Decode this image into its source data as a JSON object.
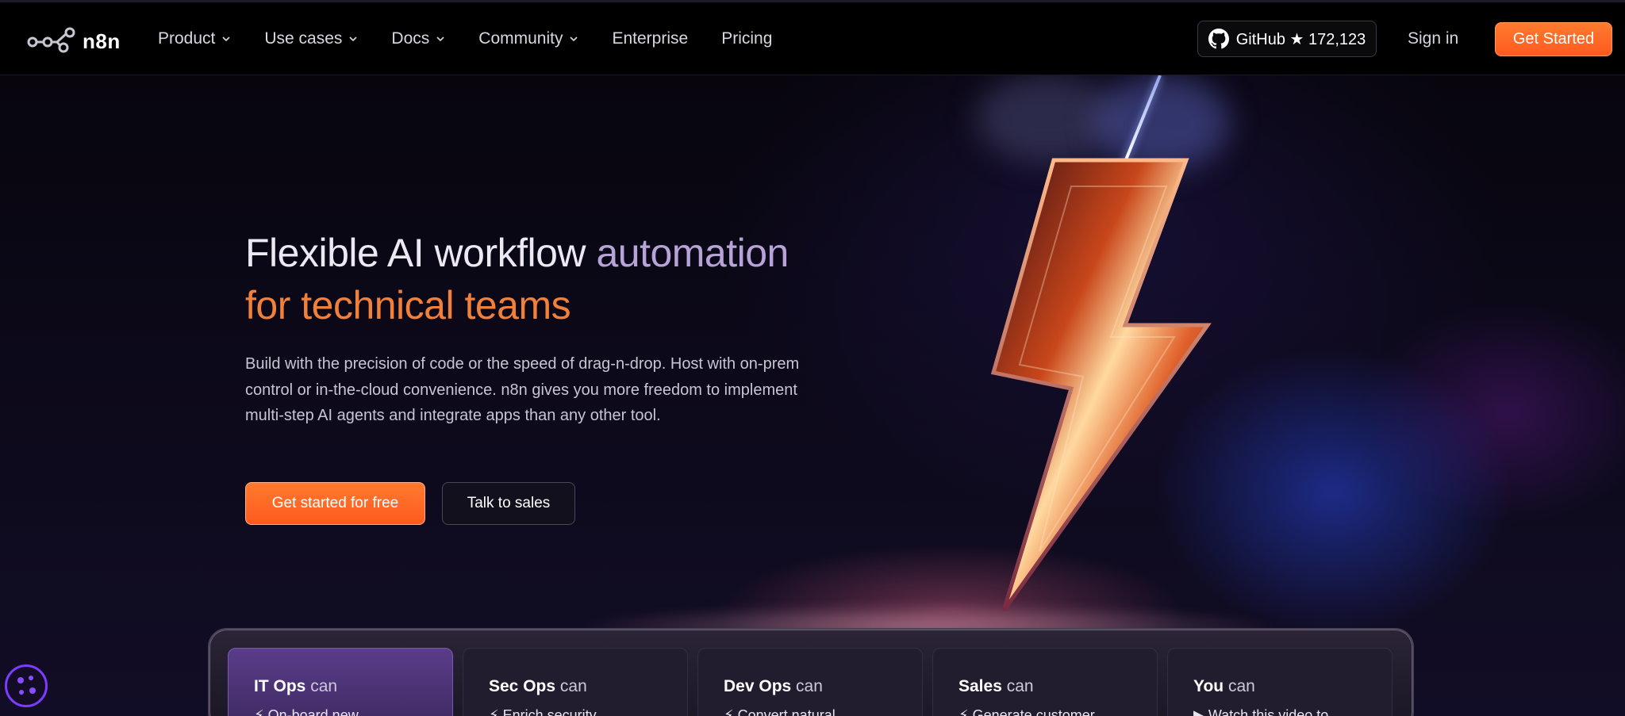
{
  "nav": {
    "logo_text": "n8n",
    "items": [
      {
        "label": "Product",
        "has_dropdown": true
      },
      {
        "label": "Use cases",
        "has_dropdown": true
      },
      {
        "label": "Docs",
        "has_dropdown": true
      },
      {
        "label": "Community",
        "has_dropdown": true
      },
      {
        "label": "Enterprise",
        "has_dropdown": false
      },
      {
        "label": "Pricing",
        "has_dropdown": false
      }
    ],
    "github_label": "GitHub ★ 172,123",
    "signin_label": "Sign in",
    "get_started_label": "Get Started"
  },
  "hero": {
    "title_line1_a": "Flexible AI workflow",
    "title_line1_b": "automation",
    "title_line2": "for technical teams",
    "description": "Build with the precision of code or the speed of drag-n-drop. Host with on-prem control or in-the-cloud convenience. n8n gives you more freedom to implement multi-step AI agents and integrate apps than any other tool.",
    "primary_cta": "Get started for free",
    "secondary_cta": "Talk to sales"
  },
  "cards": [
    {
      "team": "IT Ops",
      "suffix": "can",
      "line": "⚡ On-board new",
      "active": true
    },
    {
      "team": "Sec Ops",
      "suffix": "can",
      "line": "⚡ Enrich security",
      "active": false
    },
    {
      "team": "Dev Ops",
      "suffix": "can",
      "line": "⚡ Convert natural",
      "active": false
    },
    {
      "team": "Sales",
      "suffix": "can",
      "line": "⚡ Generate customer",
      "active": false
    },
    {
      "team": "You",
      "suffix": "can",
      "line": "▶ Watch this video to",
      "active": false
    }
  ],
  "colors": {
    "accent_orange": "#ff6a25",
    "title_purple": "#b7a3d8",
    "active_card": "#5a3c8a"
  },
  "icons": [
    "n8n-logo-icon",
    "chevron-down-icon",
    "github-icon",
    "cookie-settings-icon"
  ]
}
